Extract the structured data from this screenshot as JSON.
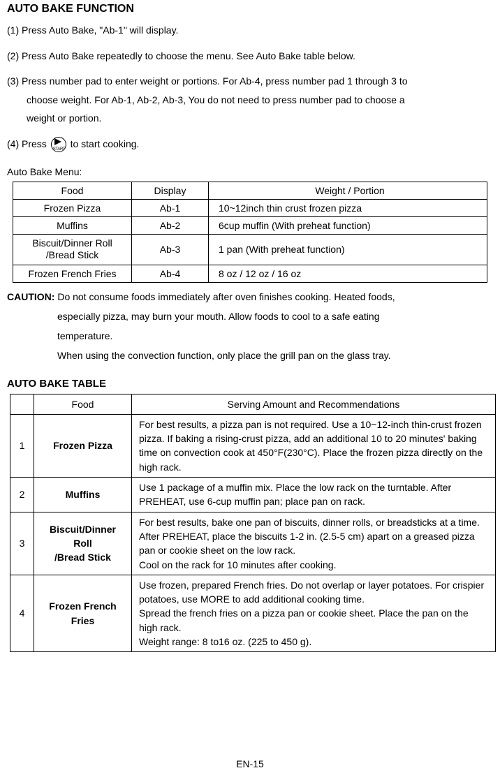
{
  "title": "AUTO BAKE FUNCTION",
  "steps": {
    "s1": "(1) Press Auto Bake, \"Ab-1\" will display.",
    "s2": "(2) Press Auto Bake repeatedly to choose the menu. See Auto Bake table below.",
    "s3a": "(3) Press number pad to enter weight or portions. For Ab-4, press number pad 1 through 3 to",
    "s3b": "choose weight. For Ab-1, Ab-2, Ab-3, You do not need to press number pad to choose a",
    "s3c": "weight or portion.",
    "s4a": "(4) Press",
    "s4b": "to start cooking."
  },
  "start_icon_label": "START",
  "menu_label": "Auto Bake Menu:",
  "menu_headers": {
    "food": "Food",
    "display": "Display",
    "wp": "Weight / Portion"
  },
  "menu_rows": [
    {
      "food": "Frozen Pizza",
      "display": "Ab-1",
      "wp": "10~12inch thin crust frozen pizza"
    },
    {
      "food": "Muffins",
      "display": "Ab-2",
      "wp": "6cup muffin (With preheat function)"
    },
    {
      "food_l1": "Biscuit/Dinner Roll",
      "food_l2": "/Bread Stick",
      "display": "Ab-3",
      "wp": "1 pan (With preheat function)"
    },
    {
      "food": "Frozen French Fries",
      "display": "Ab-4",
      "wp": "8 oz / 12 oz / 16 oz"
    }
  ],
  "caution_label": "CAUTION:",
  "caution_l1": " Do not consume foods  immediately after oven finishes  cooking. Heated foods,",
  "caution_l2": "especially pizza, may burn your mouth. Allow foods to cool to a safe eating",
  "caution_l3": "temperature.",
  "caution_l4": "When using the convection function, only place the grill pan on the glass tray.",
  "bake_table_title": "AUTO BAKE TABLE",
  "bake_headers": {
    "food": "Food",
    "rec": "Serving Amount and Recommendations"
  },
  "bake_rows": {
    "r1": {
      "num": "1",
      "food": "Frozen Pizza",
      "rec": "For best results, a pizza pan is not required. Use a 10~12-inch thin-crust frozen pizza. If baking a rising-crust pizza, add an additional 10 to 20 minutes' baking time on convection cook at 450°F(230°C). Place the frozen pizza directly on the high rack."
    },
    "r2": {
      "num": "2",
      "food": "Muffins",
      "rec": "Use 1 package of a muffin mix. Place the low rack on the turntable. After PREHEAT, use 6-cup muffin pan; place pan on rack."
    },
    "r3": {
      "num": "3",
      "food_l1": "Biscuit/Dinner",
      "food_l2": "Roll",
      "food_l3": "/Bread Stick",
      "rec_l1": "For best results, bake one pan of biscuits, dinner rolls, or breadsticks at a time.",
      "rec_l2": "After PREHEAT, place the biscuits 1-2 in. (2.5-5 cm) apart on a greased pizza pan or cookie sheet on the low rack.",
      "rec_l3": "Cool on the rack for 10 minutes after cooking."
    },
    "r4": {
      "num": "4",
      "food_l1": "Frozen French",
      "food_l2": "Fries",
      "rec_l1": "Use frozen, prepared French fries. Do not overlap or layer potatoes. For crispier potatoes, use MORE to add additional cooking time.",
      "rec_l2": "Spread the french fries on a pizza pan or cookie sheet. Place the pan on the high rack.",
      "rec_l3": "Weight range: 8 to16 oz. (225 to 450 g)."
    }
  },
  "page_number": "EN-15"
}
